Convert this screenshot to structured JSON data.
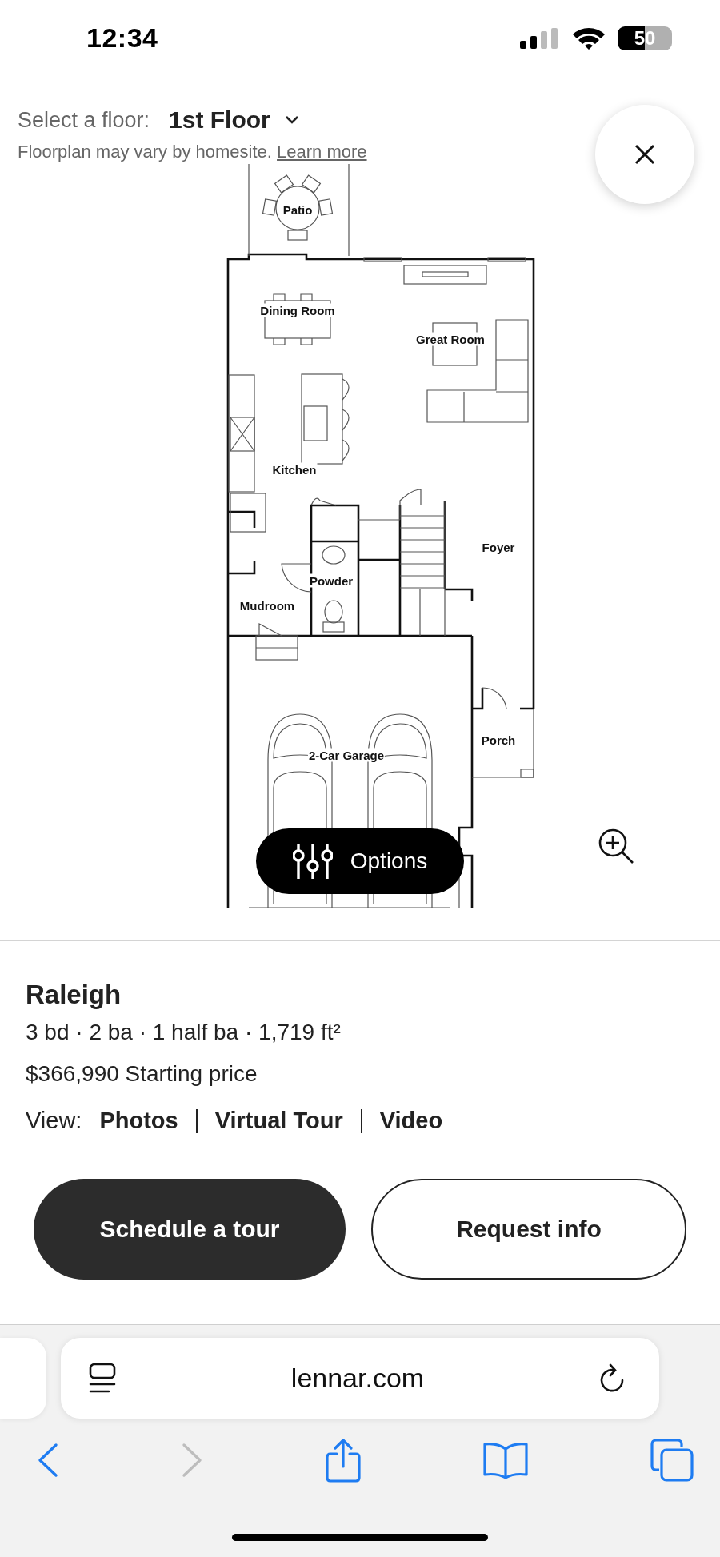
{
  "status_bar": {
    "time": "12:34",
    "battery": "50"
  },
  "floor_selector": {
    "label": "Select a floor:",
    "value": "1st Floor"
  },
  "notice": {
    "text": "Floorplan may vary by homesite.",
    "link": "Learn more"
  },
  "floorplan": {
    "rooms": [
      {
        "name": "Patio"
      },
      {
        "name": "Dining Room"
      },
      {
        "name": "Great Room"
      },
      {
        "name": "Kitchen"
      },
      {
        "name": "Foyer"
      },
      {
        "name": "Powder"
      },
      {
        "name": "Mudroom"
      },
      {
        "name": "2-Car Garage"
      },
      {
        "name": "Porch"
      }
    ]
  },
  "options_button": {
    "label": "Options"
  },
  "home": {
    "name": "Raleigh",
    "specs": "3 bd · 2 ba · 1 half ba · 1,719 ft²",
    "price": "$366,990 Starting price",
    "view_label": "View:",
    "view_links": [
      "Photos",
      "Virtual Tour",
      "Video"
    ]
  },
  "actions": [
    {
      "label": "Schedule a tour",
      "kind": "primary"
    },
    {
      "label": "Request info",
      "kind": "secondary"
    }
  ],
  "browser": {
    "url": "lennar.com",
    "back_disabled": false,
    "forward_disabled": true
  }
}
